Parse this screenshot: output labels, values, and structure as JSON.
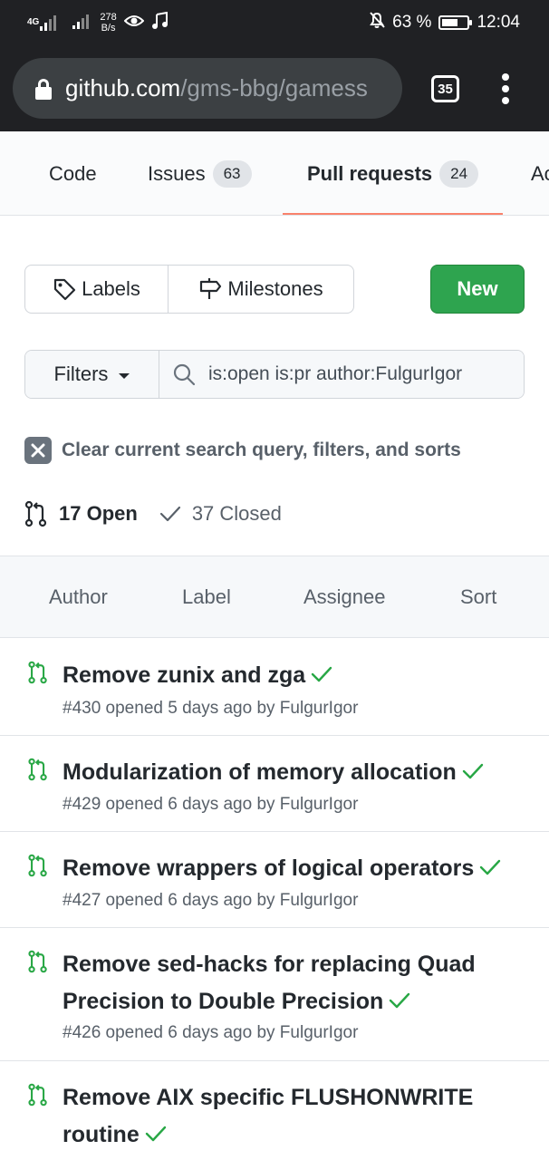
{
  "status_bar": {
    "network_type": "4G",
    "speed_value": "278",
    "speed_unit": "B/s",
    "battery": "63 %",
    "battery_level": 0.63,
    "time": "12:04"
  },
  "browser": {
    "url_host": "github.com",
    "url_path": "/gms-bbg/gamess",
    "tab_count": "35"
  },
  "repo_nav": {
    "tabs": [
      {
        "label": "Code",
        "count": ""
      },
      {
        "label": "Issues",
        "count": "63"
      },
      {
        "label": "Pull requests",
        "count": "24"
      },
      {
        "label": "Ac",
        "count": ""
      }
    ],
    "active_tab": "Pull requests"
  },
  "toolbar": {
    "labels_label": "Labels",
    "milestones_label": "Milestones",
    "new_label": "New"
  },
  "filter": {
    "filters_label": "Filters",
    "query": "is:open is:pr author:FulgurIgor"
  },
  "clear_query": "Clear current search query, filters, and sorts",
  "states": {
    "open_label": "17 Open",
    "closed_label": "37 Closed"
  },
  "sort_bar": [
    "Author",
    "Label",
    "Assignee",
    "Sort"
  ],
  "pull_requests": [
    {
      "title": "Remove zunix and zga",
      "meta": "#430 opened 5 days ago by FulgurIgor"
    },
    {
      "title": "Modularization of memory allocation",
      "meta": "#429 opened 6 days ago by FulgurIgor"
    },
    {
      "title": "Remove wrappers of logical operators",
      "meta": "#427 opened 6 days ago by FulgurIgor"
    },
    {
      "title": "Remove sed-hacks for replacing Quad Precision to Double Precision",
      "meta": "#426 opened 6 days ago by FulgurIgor"
    },
    {
      "title": "Remove AIX specific FLUSHONWRITE routine",
      "meta": ""
    }
  ],
  "colors": {
    "green": "#2ea44f",
    "pr_open": "#28a745",
    "tab_underline": "#f9826c",
    "chrome_dark": "#202124"
  }
}
